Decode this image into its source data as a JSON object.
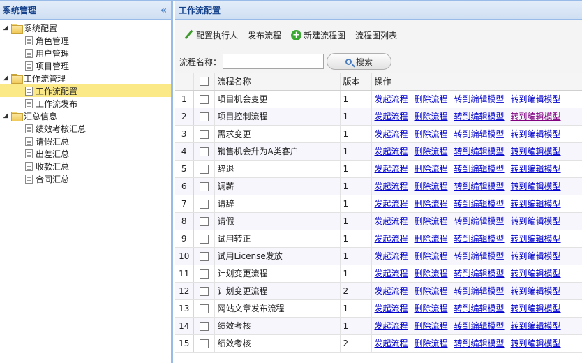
{
  "left_panel": {
    "title": "系统管理",
    "collapse_glyph": "«",
    "tree": [
      {
        "label": "系统配置",
        "type": "folder",
        "expanded": true
      },
      {
        "label": "角色管理",
        "type": "leaf"
      },
      {
        "label": "用户管理",
        "type": "leaf"
      },
      {
        "label": "项目管理",
        "type": "leaf"
      },
      {
        "label": "工作流管理",
        "type": "folder",
        "expanded": true
      },
      {
        "label": "工作流配置",
        "type": "leaf",
        "selected": true
      },
      {
        "label": "工作流发布",
        "type": "leaf"
      },
      {
        "label": "汇总信息",
        "type": "folder",
        "expanded": true
      },
      {
        "label": "绩效考核汇总",
        "type": "leaf"
      },
      {
        "label": "请假汇总",
        "type": "leaf"
      },
      {
        "label": "出差汇总",
        "type": "leaf"
      },
      {
        "label": "收款汇总",
        "type": "leaf"
      },
      {
        "label": "合同汇总",
        "type": "leaf"
      }
    ]
  },
  "main": {
    "title": "工作流配置",
    "toolbar": {
      "assign": "配置执行人",
      "publish": "发布流程",
      "new_diagram": "新建流程图",
      "diagram_list": "流程图列表"
    },
    "search": {
      "label": "流程名称：",
      "value": "",
      "button": "搜索"
    },
    "table": {
      "columns": {
        "name": "流程名称",
        "version": "版本",
        "ops": "操作"
      },
      "op_labels": [
        "发起流程",
        "删除流程",
        "转到编辑模型",
        "转到编辑模型"
      ],
      "rows": [
        {
          "idx": "1",
          "name": "项目机会变更",
          "version": "1"
        },
        {
          "idx": "2",
          "name": "项目控制流程",
          "version": "1"
        },
        {
          "idx": "3",
          "name": "需求变更",
          "version": "1"
        },
        {
          "idx": "4",
          "name": "销售机会升为A类客户",
          "version": "1"
        },
        {
          "idx": "5",
          "name": "辞退",
          "version": "1"
        },
        {
          "idx": "6",
          "name": "调薪",
          "version": "1"
        },
        {
          "idx": "7",
          "name": "请辞",
          "version": "1"
        },
        {
          "idx": "8",
          "name": "请假",
          "version": "1"
        },
        {
          "idx": "9",
          "name": "试用转正",
          "version": "1"
        },
        {
          "idx": "10",
          "name": "试用License发放",
          "version": "1"
        },
        {
          "idx": "11",
          "name": "计划变更流程",
          "version": "1"
        },
        {
          "idx": "12",
          "name": "计划变更流程",
          "version": "2"
        },
        {
          "idx": "13",
          "name": "网站文章发布流程",
          "version": "1"
        },
        {
          "idx": "14",
          "name": "绩效考核",
          "version": "1"
        },
        {
          "idx": "15",
          "name": "绩效考核",
          "version": "2"
        }
      ]
    }
  },
  "colors": {
    "header_text": "#15428b",
    "border": "#99bbe8",
    "selected_row": "#fbe987",
    "link": "#0000cc",
    "visited_link": "#800080"
  }
}
